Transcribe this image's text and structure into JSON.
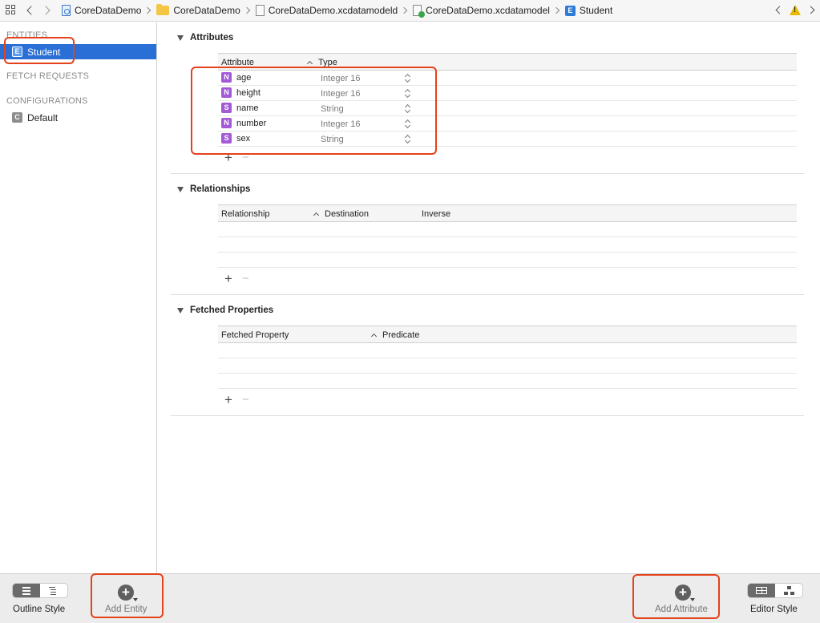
{
  "jumpbar": {
    "crumbs": [
      {
        "label": "CoreDataDemo",
        "icon": "project-file-icon"
      },
      {
        "label": "CoreDataDemo",
        "icon": "folder-icon"
      },
      {
        "label": "CoreDataDemo.xcdatamodeld",
        "icon": "model-bundle-icon"
      },
      {
        "label": "CoreDataDemo.xcdatamodel",
        "icon": "model-file-icon"
      },
      {
        "label": "Student",
        "icon": "entity-icon"
      }
    ]
  },
  "sidebar": {
    "entities_header": "ENTITIES",
    "entities": [
      {
        "badge": "E",
        "label": "Student"
      }
    ],
    "fetch_requests_header": "FETCH REQUESTS",
    "configurations_header": "CONFIGURATIONS",
    "configurations": [
      {
        "badge": "C",
        "label": "Default"
      }
    ]
  },
  "attributes": {
    "title": "Attributes",
    "col_attribute": "Attribute",
    "col_type": "Type",
    "rows": [
      {
        "badge": "N",
        "name": "age",
        "type": "Integer 16"
      },
      {
        "badge": "N",
        "name": "height",
        "type": "Integer 16"
      },
      {
        "badge": "S",
        "name": "name",
        "type": "String"
      },
      {
        "badge": "N",
        "name": "number",
        "type": "Integer 16"
      },
      {
        "badge": "S",
        "name": "sex",
        "type": "String"
      }
    ]
  },
  "relationships": {
    "title": "Relationships",
    "col_relationship": "Relationship",
    "col_destination": "Destination",
    "col_inverse": "Inverse"
  },
  "fetched": {
    "title": "Fetched Properties",
    "col_property": "Fetched Property",
    "col_predicate": "Predicate"
  },
  "bottombar": {
    "outline_style": "Outline Style",
    "add_entity": "Add Entity",
    "add_attribute": "Add Attribute",
    "editor_style": "Editor Style"
  },
  "colors": {
    "selection": "#2a6fd5",
    "highlight": "#e4421a",
    "attr_badge": "#a45ad6"
  }
}
